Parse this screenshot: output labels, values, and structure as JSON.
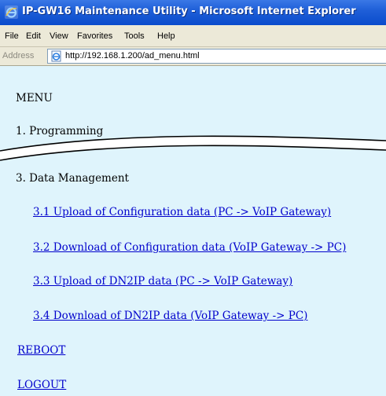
{
  "window": {
    "title": "IP-GW16 Maintenance Utility - Microsoft Internet Explorer"
  },
  "menubar": {
    "items": [
      "File",
      "Edit",
      "View",
      "Favorites",
      "Tools",
      "Help"
    ]
  },
  "address_bar": {
    "label": "Address",
    "url": "http://192.168.1.200/ad_menu.html"
  },
  "page": {
    "heading": "MENU",
    "section_1": "1. Programming",
    "section_3": "3. Data Management",
    "links": [
      "3.1 Upload of Configuration data (PC -> VoIP Gateway)",
      "3.2 Download of Configuration data (VoIP Gateway -> PC)",
      "3.3 Upload of DN2IP data (PC -> VoIP Gateway)",
      "3.4 Download of DN2IP data (VoIP Gateway -> PC)"
    ],
    "reboot": "REBOOT",
    "logout": "LOGOUT"
  },
  "colors": {
    "titlebar": "#0a4bcc",
    "content_background": "#dff4fc",
    "link": "#0000cc"
  },
  "icons": {
    "title_icon": "internet-explorer-icon",
    "address_icon": "page-icon"
  }
}
